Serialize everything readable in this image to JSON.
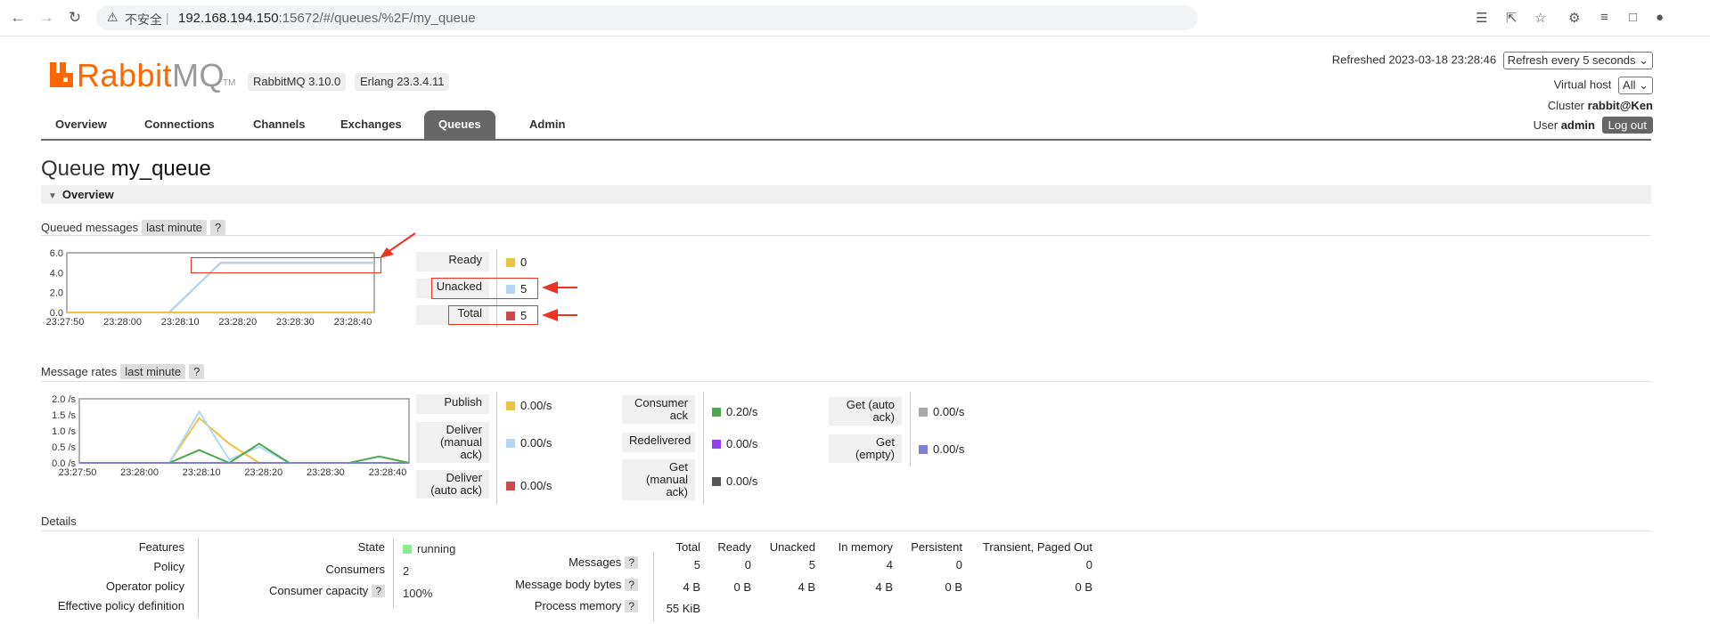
{
  "browser": {
    "insecure_label": "不安全",
    "url_host": "192.168.194.150",
    "url_rest": ":15672/#/queues/%2F/my_queue"
  },
  "brand": {
    "rabbit": "Rabbit",
    "mq": "MQ",
    "tm": "TM",
    "version": "RabbitMQ 3.10.0",
    "erlang": "Erlang 23.3.4.11",
    "accent": "#ff6600"
  },
  "header": {
    "refreshed_label": "Refreshed",
    "refreshed_time": "2023-03-18 23:28:46",
    "refresh_option": "Refresh every 5 seconds",
    "vhost_label": "Virtual host",
    "vhost_value": "All",
    "cluster_label": "Cluster",
    "cluster_value": "rabbit@Ken",
    "user_label": "User",
    "user_value": "admin",
    "logout": "Log out"
  },
  "tabs": [
    {
      "label": "Overview"
    },
    {
      "label": "Connections"
    },
    {
      "label": "Channels"
    },
    {
      "label": "Exchanges"
    },
    {
      "label": "Queues",
      "active": true
    },
    {
      "label": "Admin"
    }
  ],
  "page": {
    "title_prefix": "Queue",
    "queue_name": "my_queue",
    "section": "Overview"
  },
  "queued": {
    "label": "Queued messages",
    "range": "last minute",
    "help": "?",
    "legend": [
      {
        "label": "Ready",
        "value": "0",
        "color": "#edc240"
      },
      {
        "label": "Unacked",
        "value": "5",
        "color": "#afd8f8"
      },
      {
        "label": "Total",
        "value": "5",
        "color": "#cb4b4b"
      }
    ]
  },
  "rates": {
    "label": "Message rates",
    "range": "last minute",
    "help": "?",
    "col1": [
      {
        "label": "Publish",
        "value": "0.00/s",
        "color": "#edc240"
      },
      {
        "label": "Deliver\n(manual\nack)",
        "value": "0.00/s",
        "color": "#afd8f8"
      },
      {
        "label": "Deliver\n(auto ack)",
        "value": "0.00/s",
        "color": "#cb4b4b"
      }
    ],
    "col2": [
      {
        "label": "Consumer\nack",
        "value": "0.20/s",
        "color": "#4da74d"
      },
      {
        "label": "Redelivered",
        "value": "0.00/s",
        "color": "#9440ed"
      },
      {
        "label": "Get\n(manual\nack)",
        "value": "0.00/s",
        "color": "#555555"
      }
    ],
    "col3": [
      {
        "label": "Get (auto\nack)",
        "value": "0.00/s",
        "color": "#aaaaaa"
      },
      {
        "label": "Get\n(empty)",
        "value": "0.00/s",
        "color": "#7f7fd5"
      }
    ]
  },
  "details": {
    "label": "Details",
    "left_labels": [
      "Features",
      "Policy",
      "Operator policy",
      "Effective policy definition"
    ],
    "state_label": "State",
    "state_value": "running",
    "consumers_label": "Consumers",
    "consumers_value": "2",
    "capacity_label": "Consumer capacity",
    "capacity_value": "100%",
    "help": "?",
    "columns": [
      "Total",
      "Ready",
      "Unacked",
      "In memory",
      "Persistent",
      "Transient, Paged Out"
    ],
    "rows": [
      {
        "label": "Messages",
        "values": [
          "5",
          "0",
          "5",
          "4",
          "0",
          "0"
        ]
      },
      {
        "label": "Message body bytes",
        "values": [
          "4 B",
          "0 B",
          "4 B",
          "4 B",
          "0 B",
          "0 B"
        ]
      },
      {
        "label": "Process memory",
        "values": [
          "55 KiB"
        ]
      }
    ]
  },
  "chart_data": [
    {
      "type": "line",
      "ylim": [
        0,
        6
      ],
      "yticks": [
        "6.0",
        "4.0",
        "2.0",
        "0.0"
      ],
      "x": [
        "23:27:50",
        "23:28:00",
        "23:28:10",
        "23:28:20",
        "23:28:30",
        "23:28:40"
      ],
      "series": [
        {
          "name": "Total",
          "color": "#cb4b4b",
          "values": [
            0,
            0,
            0,
            5,
            5,
            5,
            5
          ]
        },
        {
          "name": "Unacked",
          "color": "#afd8f8",
          "values": [
            0,
            0,
            0,
            5,
            5,
            5,
            5
          ]
        },
        {
          "name": "Ready",
          "color": "#edc240",
          "values": [
            0,
            0,
            0,
            0,
            0,
            0,
            0
          ]
        }
      ]
    },
    {
      "type": "line",
      "ylim": [
        0,
        2
      ],
      "yticks": [
        "2.0 /s",
        "1.5 /s",
        "1.0 /s",
        "0.5 /s",
        "0.0 /s"
      ],
      "x": [
        "23:27:50",
        "23:28:00",
        "23:28:10",
        "23:28:20",
        "23:28:30",
        "23:28:40"
      ],
      "series": [
        {
          "name": "Publish",
          "color": "#edc240",
          "values": [
            0,
            0,
            0,
            0,
            1.4,
            0.6,
            0,
            0,
            0,
            0,
            0,
            0
          ]
        },
        {
          "name": "Deliver (manual ack)",
          "color": "#afd8f8",
          "values": [
            0,
            0,
            0,
            0,
            1.6,
            0.1,
            0.5,
            0,
            0,
            0,
            0,
            0
          ]
        },
        {
          "name": "Consumer ack",
          "color": "#4da74d",
          "values": [
            0,
            0,
            0,
            0,
            0.4,
            0,
            0.6,
            0,
            0,
            0,
            0.2,
            0
          ]
        },
        {
          "name": "Get (empty)",
          "color": "#7f7fd5",
          "values": [
            0,
            0,
            0,
            0,
            0,
            0,
            0,
            0,
            0,
            0,
            0,
            0
          ]
        }
      ]
    }
  ]
}
